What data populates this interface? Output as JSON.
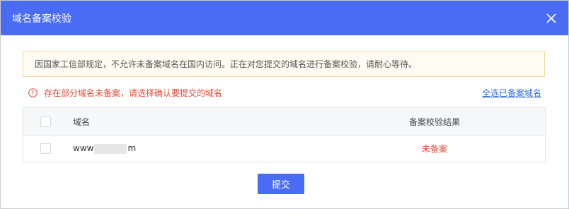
{
  "dialog": {
    "title": "域名备案校验",
    "close_icon": "close-icon"
  },
  "notice": {
    "text": "因国家工信部规定，不允许未备案域名在国内访问。正在对您提交的域名进行备案校验，请耐心等待。"
  },
  "warning": {
    "icon": "alert-circle-icon",
    "text": "存在部分域名未备案，请选择确认要提交的域名",
    "select_all_link": "全选已备案域名"
  },
  "table": {
    "headers": {
      "domain": "域名",
      "result": "备案校验结果"
    },
    "rows": [
      {
        "domain_prefix": "www",
        "domain_suffix": "m",
        "result": "未备案",
        "checked": false
      }
    ]
  },
  "submit_label": "提交",
  "colors": {
    "primary": "#4a6cf5",
    "error": "#e04b3a",
    "link": "#2f6bdb"
  }
}
